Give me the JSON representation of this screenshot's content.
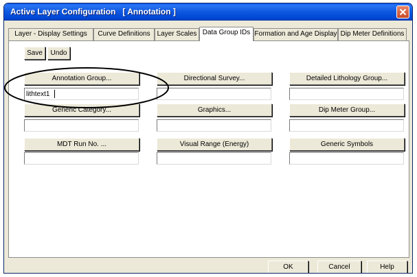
{
  "window": {
    "title": "Active Layer Configuration   [ Annotation ]"
  },
  "tabs": [
    {
      "label": "Layer - Display Settings",
      "active": false
    },
    {
      "label": "Curve Definitions",
      "active": false
    },
    {
      "label": "Layer Scales",
      "active": false
    },
    {
      "label": "Data Group IDs",
      "active": true
    },
    {
      "label": "Formation and Age Display",
      "active": false
    },
    {
      "label": "Dip Meter Definitions",
      "active": false
    }
  ],
  "toolbar": {
    "save_label": "Save",
    "undo_label": "Undo"
  },
  "groups": [
    {
      "label": "Annotation Group...",
      "value": "lithtext1"
    },
    {
      "label": "Directional Survey...",
      "value": ""
    },
    {
      "label": "Detailed Lithology Group...",
      "value": ""
    },
    {
      "label": "Generic Category...",
      "value": ""
    },
    {
      "label": "Graphics...",
      "value": ""
    },
    {
      "label": "Dip Meter Group...",
      "value": ""
    },
    {
      "label": "MDT Run No. ...",
      "value": ""
    },
    {
      "label": "Visual Range (Energy)",
      "value": ""
    },
    {
      "label": "Generic Symbols",
      "value": ""
    }
  ],
  "footer": {
    "ok_label": "OK",
    "cancel_label": "Cancel",
    "help_label": "Help"
  },
  "icons": {
    "close": "close-icon"
  },
  "colors": {
    "titlebar": "#0054e3",
    "dialog_face": "#ece9d8",
    "close_button": "#d9582f"
  }
}
